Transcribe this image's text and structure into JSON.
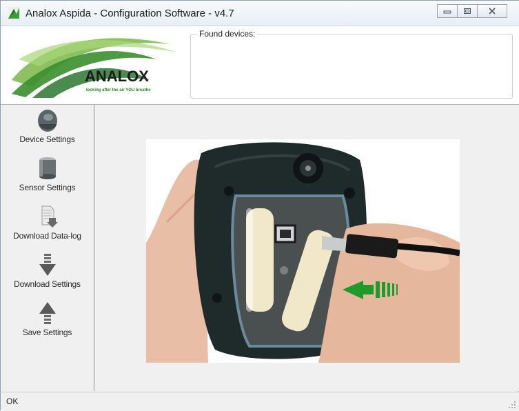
{
  "window": {
    "title": "Analox Aspida - Configuration Software - v4.7",
    "controls": [
      "minimize",
      "maximize",
      "close"
    ]
  },
  "header": {
    "logo_brand": "ANALOX",
    "logo_tagline": "looking after the air YOU breathe",
    "found_devices_label": "Found devices:"
  },
  "sidebar": {
    "items": [
      {
        "label": "Device Settings",
        "icon": "device-icon"
      },
      {
        "label": "Sensor Settings",
        "icon": "sensor-icon"
      },
      {
        "label": "Download Data-log",
        "icon": "download-datalog-icon"
      },
      {
        "label": "Download Settings",
        "icon": "download-arrow-icon"
      },
      {
        "label": "Save Settings",
        "icon": "upload-arrow-icon"
      }
    ]
  },
  "main": {
    "image": "device-usb-connection-photo"
  },
  "status": {
    "text": "OK"
  },
  "colors": {
    "brand_green": "#2f8a2f",
    "accent_green": "#1e9b2a",
    "device_dark": "#1f2a2a"
  }
}
